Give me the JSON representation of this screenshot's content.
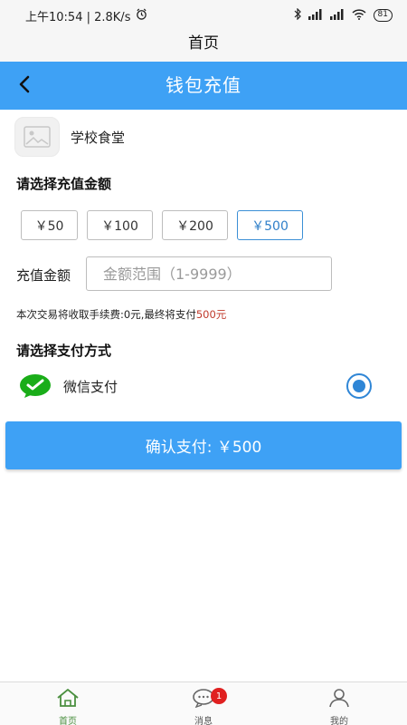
{
  "status_bar": {
    "time_speed": "上午10:54 | 2.8K/s",
    "battery": "81"
  },
  "app_header": {
    "title": "首页"
  },
  "nav": {
    "title": "钱包充值"
  },
  "merchant": {
    "name": "学校食堂"
  },
  "amount_section": {
    "title": "请选择充值金额",
    "options": [
      "￥50",
      "￥100",
      "￥200",
      "￥500"
    ],
    "selected_index": 3
  },
  "custom_amount": {
    "label": "充值金额",
    "placeholder": "金额范围（1-9999）"
  },
  "fee_note": {
    "text": "本次交易将收取手续费:0元,最终将支付",
    "amount": "500元"
  },
  "payment_section": {
    "title": "请选择支付方式",
    "method": "微信支付",
    "selected": true
  },
  "confirm": {
    "label": "确认支付: ￥500"
  },
  "tabs": [
    {
      "label": "首页",
      "icon": "home-icon",
      "active": true
    },
    {
      "label": "消息",
      "icon": "message-icon",
      "badge": "1"
    },
    {
      "label": "我的",
      "icon": "user-icon"
    }
  ],
  "colors": {
    "primary": "#3ea1f5",
    "selected_border": "#3b8fd6",
    "wechat_green": "#1aad19",
    "fee_red": "#c0392b",
    "badge_red": "#e02020",
    "active_tab": "#4a8f3f"
  }
}
